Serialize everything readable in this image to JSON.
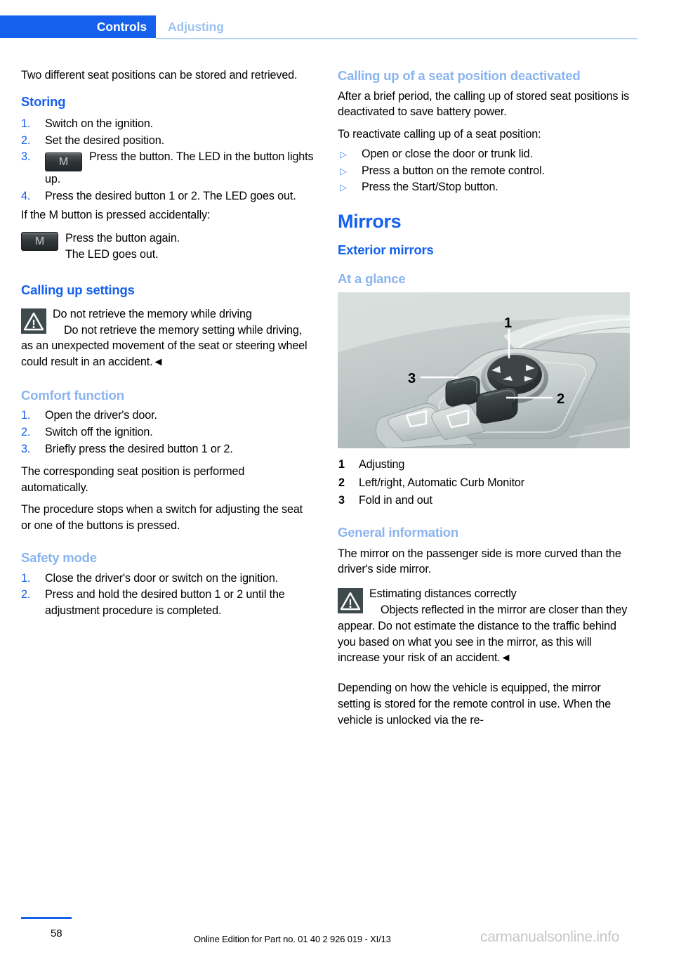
{
  "header": {
    "chapter": "Controls",
    "section": "Adjusting"
  },
  "left_column": {
    "intro": "Two different seat positions can be stored and retrieved.",
    "storing": {
      "heading": "Storing",
      "steps": [
        {
          "marker": "1.",
          "text": "Switch on the ignition."
        },
        {
          "marker": "2.",
          "text": "Set the desired position."
        },
        {
          "marker": "3.",
          "icon": "M",
          "text": "Press the button. The LED in the button lights up."
        },
        {
          "marker": "4.",
          "text": "Press the desired button 1 or 2. The LED goes out."
        }
      ],
      "accidental_intro": "If the M button is pressed accidentally:",
      "accidental_icon": "M",
      "accidental_line1": "Press the button again.",
      "accidental_line2": "The LED goes out."
    },
    "calling_up": {
      "heading": "Calling up settings",
      "warning_icon": "warning-triangle-icon",
      "warning_title": "Do not retrieve the memory while driving",
      "warning_text": "Do not retrieve the memory setting while driving, as an unexpected movement of the seat or steering wheel could result in an accident.◄"
    },
    "comfort": {
      "heading": "Comfort function",
      "steps": [
        {
          "marker": "1.",
          "text": "Open the driver's door."
        },
        {
          "marker": "2.",
          "text": "Switch off the ignition."
        },
        {
          "marker": "3.",
          "text": "Briefly press the desired button 1 or 2."
        }
      ],
      "para1": "The corresponding seat position is performed automatically.",
      "para2": "The procedure stops when a switch for adjusting the seat or one of the buttons is pressed."
    },
    "safety": {
      "heading": "Safety mode",
      "steps": [
        {
          "marker": "1.",
          "text": "Close the driver's door or switch on the ignition."
        },
        {
          "marker": "2.",
          "text": "Press and hold the desired button 1 or 2 until the adjustment procedure is completed."
        }
      ]
    }
  },
  "right_column": {
    "deactivated": {
      "heading": "Calling up of a seat position deactivated",
      "para1": "After a brief period, the calling up of stored seat positions is deactivated to save battery power.",
      "para2": "To reactivate calling up of a seat position:",
      "bullets": [
        {
          "marker": "▷",
          "text": "Open or close the door or trunk lid."
        },
        {
          "marker": "▷",
          "text": "Press a button on the remote control."
        },
        {
          "marker": "▷",
          "text": "Press the Start/Stop button."
        }
      ]
    },
    "mirrors": {
      "chapter_heading": "Mirrors",
      "section_heading": "Exterior mirrors",
      "at_a_glance_heading": "At a glance",
      "illustration_name": "door-panel-mirror-controls-illustration",
      "illustration_callouts": [
        "1",
        "2",
        "3"
      ],
      "legend": [
        {
          "marker": "1",
          "text": "Adjusting"
        },
        {
          "marker": "2",
          "text": "Left/right, Automatic Curb Monitor"
        },
        {
          "marker": "3",
          "text": "Fold in and out"
        }
      ],
      "general": {
        "heading": "General information",
        "para1": "The mirror on the passenger side is more curved than the driver's side mirror.",
        "warning_icon": "warning-triangle-icon",
        "warning_title": "Estimating distances correctly",
        "warning_text": "Objects reflected in the mirror are closer than they appear. Do not estimate the distance to the traffic behind you based on what you see in the mirror, as this will increase your risk of an accident.◄",
        "para2": "Depending on how the vehicle is equipped, the mirror setting is stored for the remote control in use. When the vehicle is unlocked via the re-"
      }
    }
  },
  "footer": {
    "page_number": "58",
    "edition": "Online Edition for Part no. 01 40 2 926 019 - XI/13",
    "watermark": "carmanualsonline.info"
  },
  "colors": {
    "accent_blue": "#1560ec",
    "light_blue": "#8ab4ef",
    "header_inactive": "#9cc2f2",
    "rule_blue": "#b9d3f5",
    "warn_icon_bg": "#3e4a4c",
    "watermark_gray": "#c6c6c6"
  }
}
